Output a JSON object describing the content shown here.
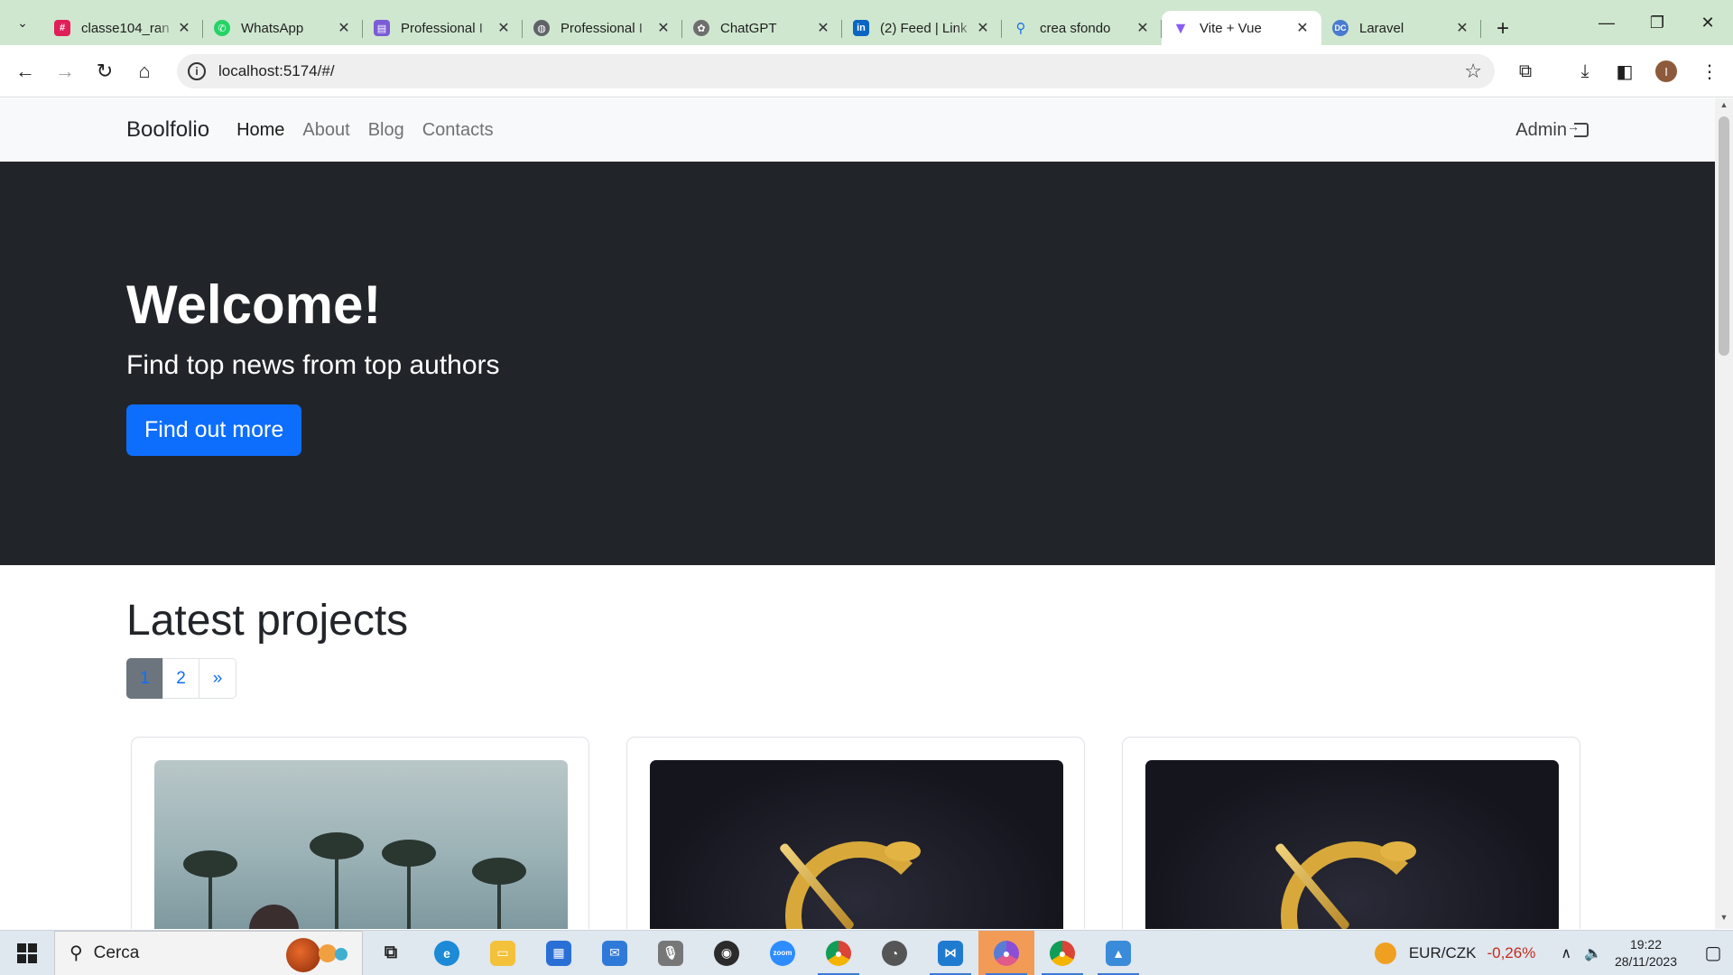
{
  "browser": {
    "tabs": [
      {
        "title": "classe104_ran",
        "color": "#e01e5a",
        "icon": "slack-icon"
      },
      {
        "title": "WhatsApp",
        "color": "#25d366",
        "icon": "whatsapp-icon"
      },
      {
        "title": "Professional I",
        "color": "#7b5cd6",
        "icon": "printer-icon"
      },
      {
        "title": "Professional I",
        "color": "#5f6368",
        "icon": "globe-icon"
      },
      {
        "title": "ChatGPT",
        "color": "#6e6e6e",
        "icon": "chatgpt-icon"
      },
      {
        "title": "(2) Feed | Link",
        "color": "#0a66c2",
        "icon": "linkedin-icon"
      },
      {
        "title": "crea sfondo",
        "color": "#1a73e8",
        "icon": "search-icon"
      },
      {
        "title": "Vite + Vue",
        "color": "#8a5cf6",
        "icon": "vite-icon",
        "active": true
      },
      {
        "title": "Laravel",
        "color": "#4a7bd0",
        "icon": "laravel-icon"
      }
    ],
    "url": "localhost:5174/#/",
    "profile_initial": "I"
  },
  "site": {
    "brand": "Boolfolio",
    "nav": [
      "Home",
      "About",
      "Blog",
      "Contacts"
    ],
    "admin": "Admin",
    "hero": {
      "title": "Welcome!",
      "subtitle": "Find top news from top authors",
      "cta": "Find out more"
    },
    "latest": {
      "title": "Latest projects",
      "pages": [
        "1",
        "2",
        "»"
      ],
      "current_page": "1"
    }
  },
  "taskbar": {
    "search_placeholder": "Cerca",
    "currency_pair": "EUR/CZK",
    "currency_change": "-0,26%",
    "time": "19:22",
    "date": "28/11/2023"
  },
  "colors": {
    "primary": "#0d6efd",
    "hero_bg": "#212529",
    "navbar_bg": "#f8f9fa",
    "tabstrip_bg": "#cfe7cf"
  }
}
